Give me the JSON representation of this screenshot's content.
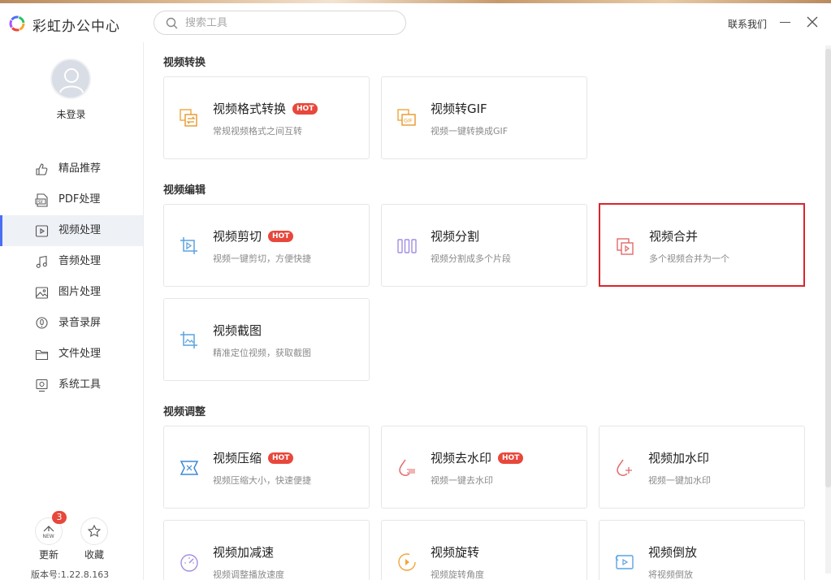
{
  "app": {
    "title": "彩虹办公中心",
    "contact_label": "联系我们",
    "logo_icon": "rainbow-ring-logo",
    "accent_color": "#4a6ff5",
    "hot_color": "#e8473b",
    "highlight_color": "#d9262c"
  },
  "search": {
    "placeholder": "搜索工具",
    "value": "",
    "icon": "search-icon"
  },
  "user": {
    "login_status": "未登录",
    "avatar_icon": "user-avatar-icon"
  },
  "sidebar": {
    "items": [
      {
        "label": "精品推荐",
        "icon": "thumbs-up-icon",
        "active": false
      },
      {
        "label": "PDF处理",
        "icon": "pdf-icon",
        "active": false
      },
      {
        "label": "视频处理",
        "icon": "video-icon",
        "active": true
      },
      {
        "label": "音频处理",
        "icon": "music-note-icon",
        "active": false
      },
      {
        "label": "图片处理",
        "icon": "image-icon",
        "active": false
      },
      {
        "label": "录音录屏",
        "icon": "microphone-icon",
        "active": false
      },
      {
        "label": "文件处理",
        "icon": "folder-icon",
        "active": false
      },
      {
        "label": "系统工具",
        "icon": "monitor-icon",
        "active": false
      }
    ],
    "update": {
      "label": "更新",
      "badge": "3",
      "icon": "new-update-icon"
    },
    "favorites": {
      "label": "收藏",
      "icon": "star-icon"
    },
    "version": "版本号:1.22.8.163"
  },
  "sections": [
    {
      "title": "视频转换",
      "cards": [
        {
          "title": "视频格式转换",
          "desc": "常规视频格式之间互转",
          "hot": "HOT",
          "icon": "format-convert-icon"
        },
        {
          "title": "视频转GIF",
          "desc": "视频一键转换成GIF",
          "hot": "",
          "icon": "gif-icon"
        }
      ]
    },
    {
      "title": "视频编辑",
      "cards": [
        {
          "title": "视频剪切",
          "desc": "视频一键剪切，方便快捷",
          "hot": "HOT",
          "icon": "crop-icon"
        },
        {
          "title": "视频分割",
          "desc": "视频分割成多个片段",
          "hot": "",
          "icon": "split-icon"
        },
        {
          "title": "视频合并",
          "desc": "多个视频合并为一个",
          "hot": "",
          "icon": "merge-icon",
          "selected": true
        },
        {
          "title": "视频截图",
          "desc": "精准定位视频，获取截图",
          "hot": "",
          "icon": "screenshot-icon"
        }
      ]
    },
    {
      "title": "视频调整",
      "cards": [
        {
          "title": "视频压缩",
          "desc": "视频压缩大小，快速便捷",
          "hot": "HOT",
          "icon": "compress-icon"
        },
        {
          "title": "视频去水印",
          "desc": "视频一键去水印",
          "hot": "HOT",
          "icon": "remove-watermark-icon"
        },
        {
          "title": "视频加水印",
          "desc": "视频一键加水印",
          "hot": "",
          "icon": "add-watermark-icon"
        },
        {
          "title": "视频加减速",
          "desc": "视频调整播放速度",
          "hot": "",
          "icon": "speed-gauge-icon"
        },
        {
          "title": "视频旋转",
          "desc": "视频旋转角度",
          "hot": "",
          "icon": "rotate-icon"
        },
        {
          "title": "视频倒放",
          "desc": "将视频倒放",
          "hot": "",
          "icon": "reverse-play-icon"
        }
      ]
    }
  ]
}
